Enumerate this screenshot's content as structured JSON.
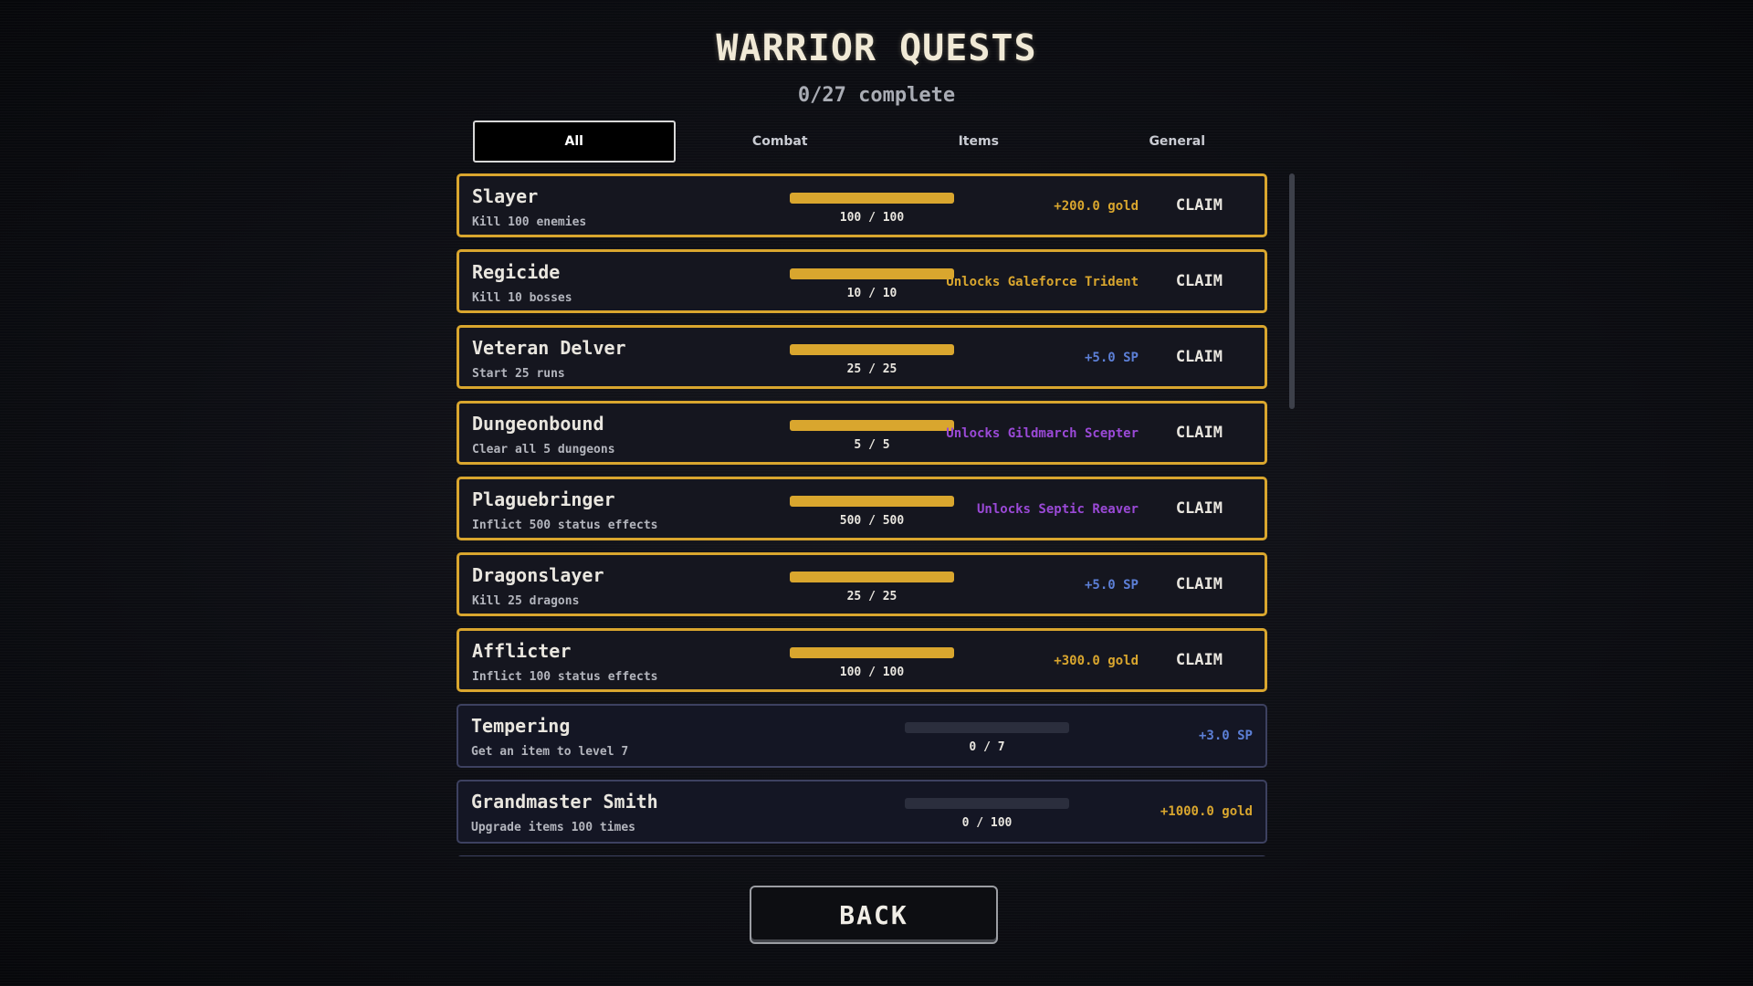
{
  "header": {
    "title": "WARRIOR QUESTS",
    "progress_text": "0/27 complete"
  },
  "tabs": [
    {
      "label": "All",
      "active": true
    },
    {
      "label": "Combat",
      "active": false
    },
    {
      "label": "Items",
      "active": false
    },
    {
      "label": "General",
      "active": false
    }
  ],
  "colors": {
    "accent_gold": "#d9a62e",
    "sp_blue": "#5c7fd6",
    "unlock_purple": "#9a49d6",
    "incomplete_border": "#3d4160"
  },
  "claim_label": "CLAIM",
  "quests": [
    {
      "name": "Slayer",
      "desc": "Kill 100 enemies",
      "progress": "100 / 100",
      "fraction": 1.0,
      "reward": "+200.0 gold",
      "reward_type": "gold",
      "complete": true
    },
    {
      "name": "Regicide",
      "desc": "Kill 10 bosses",
      "progress": "10 / 10",
      "fraction": 1.0,
      "reward": "Unlocks Galeforce Trident",
      "reward_type": "gold",
      "complete": true
    },
    {
      "name": "Veteran Delver",
      "desc": "Start 25 runs",
      "progress": "25 / 25",
      "fraction": 1.0,
      "reward": "+5.0 SP",
      "reward_type": "sp",
      "complete": true
    },
    {
      "name": "Dungeonbound",
      "desc": "Clear all 5 dungeons",
      "progress": "5 / 5",
      "fraction": 1.0,
      "reward": "Unlocks Gildmarch Scepter",
      "reward_type": "purple",
      "complete": true
    },
    {
      "name": "Plaguebringer",
      "desc": "Inflict 500 status effects",
      "progress": "500 / 500",
      "fraction": 1.0,
      "reward": "Unlocks Septic Reaver",
      "reward_type": "purple",
      "complete": true
    },
    {
      "name": "Dragonslayer",
      "desc": "Kill 25 dragons",
      "progress": "25 / 25",
      "fraction": 1.0,
      "reward": "+5.0 SP",
      "reward_type": "sp",
      "complete": true
    },
    {
      "name": "Afflicter",
      "desc": "Inflict 100 status effects",
      "progress": "100 / 100",
      "fraction": 1.0,
      "reward": "+300.0 gold",
      "reward_type": "gold",
      "complete": true
    },
    {
      "name": "Tempering",
      "desc": "Get an item to level 7",
      "progress": "0 / 7",
      "fraction": 0.0,
      "reward": "+3.0 SP",
      "reward_type": "sp",
      "complete": false
    },
    {
      "name": "Grandmaster Smith",
      "desc": "Upgrade items 100 times",
      "progress": "0 / 100",
      "fraction": 0.0,
      "reward": "+1000.0 gold",
      "reward_type": "gold",
      "complete": false
    }
  ],
  "back_label": "BACK"
}
